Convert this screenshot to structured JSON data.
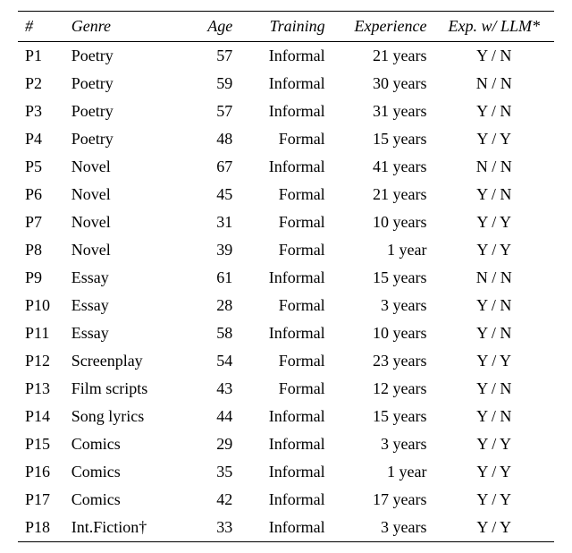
{
  "chart_data": {
    "type": "table",
    "columns": [
      "#",
      "Genre",
      "Age",
      "Training",
      "Experience",
      "Exp. w/ LLM*"
    ],
    "rows": [
      {
        "id": "P1",
        "genre": "Poetry",
        "age": "57",
        "training": "Informal",
        "experience": "21 years",
        "llm": "Y / N"
      },
      {
        "id": "P2",
        "genre": "Poetry",
        "age": "59",
        "training": "Informal",
        "experience": "30 years",
        "llm": "N / N"
      },
      {
        "id": "P3",
        "genre": "Poetry",
        "age": "57",
        "training": "Informal",
        "experience": "31 years",
        "llm": "Y / N"
      },
      {
        "id": "P4",
        "genre": "Poetry",
        "age": "48",
        "training": "Formal",
        "experience": "15 years",
        "llm": "Y / Y"
      },
      {
        "id": "P5",
        "genre": "Novel",
        "age": "67",
        "training": "Informal",
        "experience": "41 years",
        "llm": "N / N"
      },
      {
        "id": "P6",
        "genre": "Novel",
        "age": "45",
        "training": "Formal",
        "experience": "21 years",
        "llm": "Y / N"
      },
      {
        "id": "P7",
        "genre": "Novel",
        "age": "31",
        "training": "Formal",
        "experience": "10 years",
        "llm": "Y / Y"
      },
      {
        "id": "P8",
        "genre": "Novel",
        "age": "39",
        "training": "Formal",
        "experience": "1 year",
        "llm": "Y / Y"
      },
      {
        "id": "P9",
        "genre": "Essay",
        "age": "61",
        "training": "Informal",
        "experience": "15 years",
        "llm": "N / N"
      },
      {
        "id": "P10",
        "genre": "Essay",
        "age": "28",
        "training": "Formal",
        "experience": "3 years",
        "llm": "Y / N"
      },
      {
        "id": "P11",
        "genre": "Essay",
        "age": "58",
        "training": "Informal",
        "experience": "10 years",
        "llm": "Y / N"
      },
      {
        "id": "P12",
        "genre": "Screenplay",
        "age": "54",
        "training": "Formal",
        "experience": "23 years",
        "llm": "Y / Y"
      },
      {
        "id": "P13",
        "genre": "Film scripts",
        "age": "43",
        "training": "Formal",
        "experience": "12 years",
        "llm": "Y / N"
      },
      {
        "id": "P14",
        "genre": "Song lyrics",
        "age": "44",
        "training": "Informal",
        "experience": "15 years",
        "llm": "Y / N"
      },
      {
        "id": "P15",
        "genre": "Comics",
        "age": "29",
        "training": "Informal",
        "experience": "3 years",
        "llm": "Y / Y"
      },
      {
        "id": "P16",
        "genre": "Comics",
        "age": "35",
        "training": "Informal",
        "experience": "1 year",
        "llm": "Y / Y"
      },
      {
        "id": "P17",
        "genre": "Comics",
        "age": "42",
        "training": "Informal",
        "experience": "17 years",
        "llm": "Y / Y"
      },
      {
        "id": "P18",
        "genre": "Int.Fiction†",
        "age": "33",
        "training": "Informal",
        "experience": "3 years",
        "llm": "Y / Y"
      }
    ]
  }
}
